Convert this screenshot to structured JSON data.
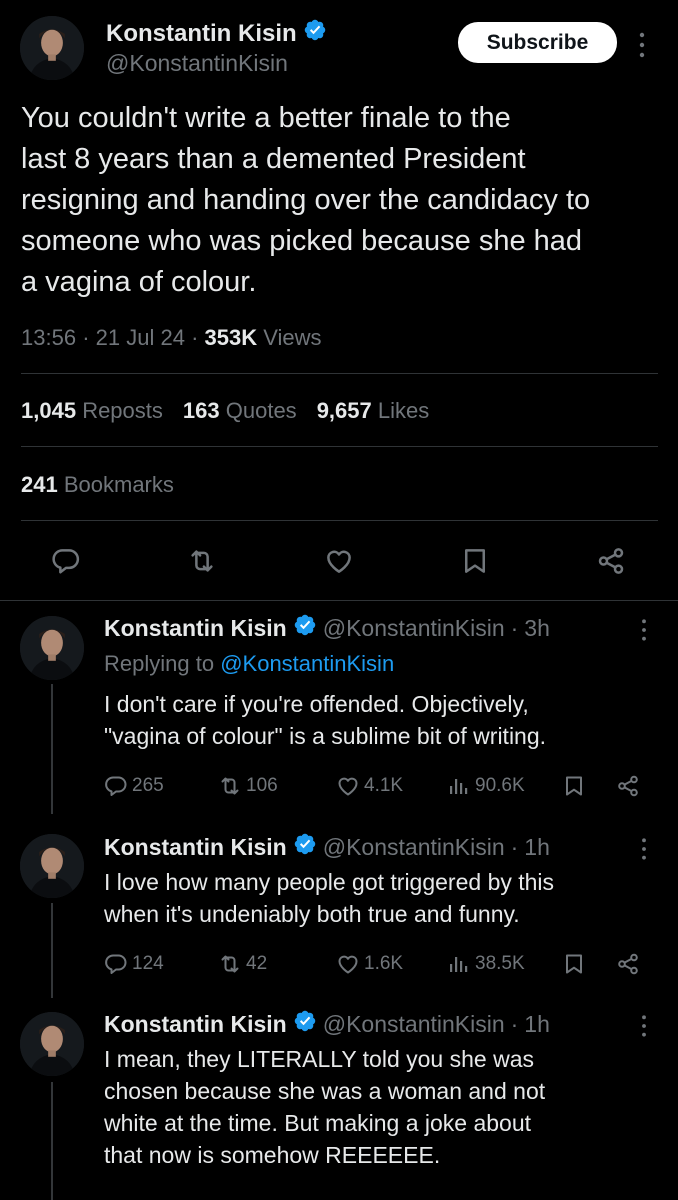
{
  "main_tweet": {
    "author_name": "Konstantin Kisin",
    "author_handle": "@KonstantinKisin",
    "subscribe_label": "Subscribe",
    "text_lines": [
      "You couldn't write a better finale to the",
      "last 8 years than a demented President",
      "resigning and handing over the candidacy to",
      "someone who was picked because she had",
      "a vagina of colour."
    ],
    "time": "13:56",
    "date": "21 Jul 24",
    "views_count": "353K",
    "views_label": "Views",
    "reposts_count": "1,045",
    "reposts_label": "Reposts",
    "quotes_count": "163",
    "quotes_label": "Quotes",
    "likes_count": "9,657",
    "likes_label": "Likes",
    "bookmarks_count": "241",
    "bookmarks_label": "Bookmarks"
  },
  "replies": [
    {
      "author_name": "Konstantin Kisin",
      "author_handle": "@KonstantinKisin",
      "age": "3h",
      "replying_prefix": "Replying to",
      "replying_to": "@KonstantinKisin",
      "text_lines": [
        "I don't care if you're offended. Objectively,",
        "\"vagina of colour\" is a sublime bit of writing."
      ],
      "replies": "265",
      "reposts": "106",
      "likes": "4.1K",
      "views": "90.6K"
    },
    {
      "author_name": "Konstantin Kisin",
      "author_handle": "@KonstantinKisin",
      "age": "1h",
      "text_lines": [
        "I love how many people got triggered by this",
        "when it's undeniably both true and funny."
      ],
      "replies": "124",
      "reposts": "42",
      "likes": "1.6K",
      "views": "38.5K"
    },
    {
      "author_name": "Konstantin Kisin",
      "author_handle": "@KonstantinKisin",
      "age": "1h",
      "text_lines": [
        "I mean, they LITERALLY told you she was",
        "chosen because she was a woman and not",
        "white at the time. But making a joke about",
        "that now is somehow REEEEEE."
      ]
    }
  ],
  "separator": "·",
  "colors": {
    "background": "#000000",
    "text_primary": "#e7e9ea",
    "text_secondary": "#71767b",
    "verified": "#1d9bf0",
    "divider": "#2f3336"
  },
  "icons": [
    "verified-badge-icon",
    "more-icon",
    "reply-icon",
    "repost-icon",
    "like-icon",
    "bookmark-icon",
    "share-icon",
    "views-icon"
  ]
}
